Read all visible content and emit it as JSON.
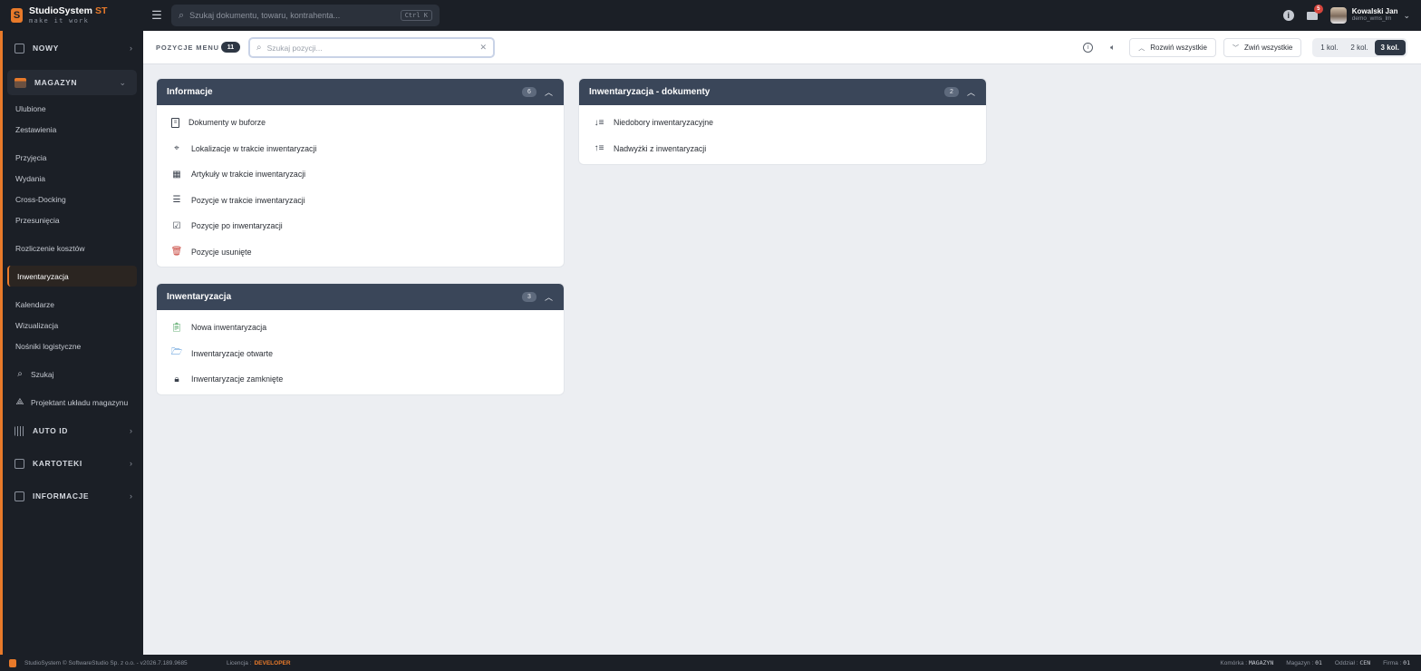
{
  "app": {
    "brand_name": "StudioSystem",
    "brand_suffix": "ST",
    "brand_tagline": "make it work",
    "search_placeholder": "Szukaj dokumentu, towaru, kontrahenta...",
    "search_shortcut": "Ctrl K",
    "messages_badge": "5",
    "user_name": "Kowalski Jan",
    "user_login": "demo_wms_lm"
  },
  "sidebar": {
    "nowy": "NOWY",
    "magazyn": "MAGAZYN",
    "items": [
      {
        "label": "Ulubione"
      },
      {
        "label": "Zestawienia"
      },
      {
        "label": "Przyjęcia"
      },
      {
        "label": "Wydania"
      },
      {
        "label": "Cross-Docking"
      },
      {
        "label": "Przesunięcia"
      },
      {
        "label": "Rozliczenie kosztów"
      },
      {
        "label": "Inwentaryzacja"
      },
      {
        "label": "Kalendarze"
      },
      {
        "label": "Wizualizacja"
      },
      {
        "label": "Nośniki logistyczne"
      },
      {
        "label": "Szukaj"
      },
      {
        "label": "Projektant układu magazynu"
      }
    ],
    "auto_id": "AUTO ID",
    "kartoteki": "KARTOTEKI",
    "informacje": "INFORMACJE"
  },
  "toolbar": {
    "label": "POZYCJE MENU",
    "count": "11",
    "search_placeholder": "Szukaj pozycji...",
    "expand_all": "Rozwiń wszystkie",
    "collapse_all": "Zwiń wszystkie",
    "col_options": [
      "1 kol.",
      "2 kol.",
      "3 kol."
    ],
    "active_col": "3 kol."
  },
  "cards": {
    "informacje": {
      "title": "Informacje",
      "count": "6",
      "items": [
        {
          "label": "Dokumenty w buforze",
          "icon": "document-icon"
        },
        {
          "label": "Lokalizacje w trakcie inwentaryzacji",
          "icon": "locations-icon"
        },
        {
          "label": "Artykuły w trakcie inwentaryzacji",
          "icon": "boxes-icon"
        },
        {
          "label": "Pozycje w trakcie inwentaryzacji",
          "icon": "checklist-icon"
        },
        {
          "label": "Pozycje po inwentaryzacji",
          "icon": "checkbox-icon"
        },
        {
          "label": "Pozycje usunięte",
          "icon": "trash-icon"
        }
      ]
    },
    "inwentaryzacja": {
      "title": "Inwentaryzacja",
      "count": "3",
      "items": [
        {
          "label": "Nowa inwentaryzacja",
          "icon": "clipboard-plus-icon"
        },
        {
          "label": "Inwentaryzacje otwarte",
          "icon": "folder-open-icon"
        },
        {
          "label": "Inwentaryzacje zamknięte",
          "icon": "lock-icon"
        }
      ]
    },
    "dokumenty": {
      "title": "Inwentaryzacja - dokumenty",
      "count": "2",
      "items": [
        {
          "label": "Niedobory inwentaryzacyjne",
          "icon": "sort-descending-icon"
        },
        {
          "label": "Nadwyżki z inwentaryzacji",
          "icon": "sort-ascending-icon"
        }
      ]
    }
  },
  "footer": {
    "copyright": "StudioSystem © SoftwareStudio Sp. z o.o. - v2026.7.189.9685",
    "license_label": "Licencja :",
    "license_value": "DEVELOPER",
    "komorka_label": "Komórka :",
    "komorka_value": "MAGAZYN",
    "magazyn_label": "Magazyn :",
    "magazyn_value": "01",
    "oddzial_label": "Oddział :",
    "oddzial_value": "CEN",
    "firma_label": "Firma :",
    "firma_value": "01"
  },
  "colors": {
    "accent": "#e87a2a",
    "sidebar_bg": "#1b1f26",
    "card_header": "#3a4659",
    "page_bg": "#eceef2"
  }
}
